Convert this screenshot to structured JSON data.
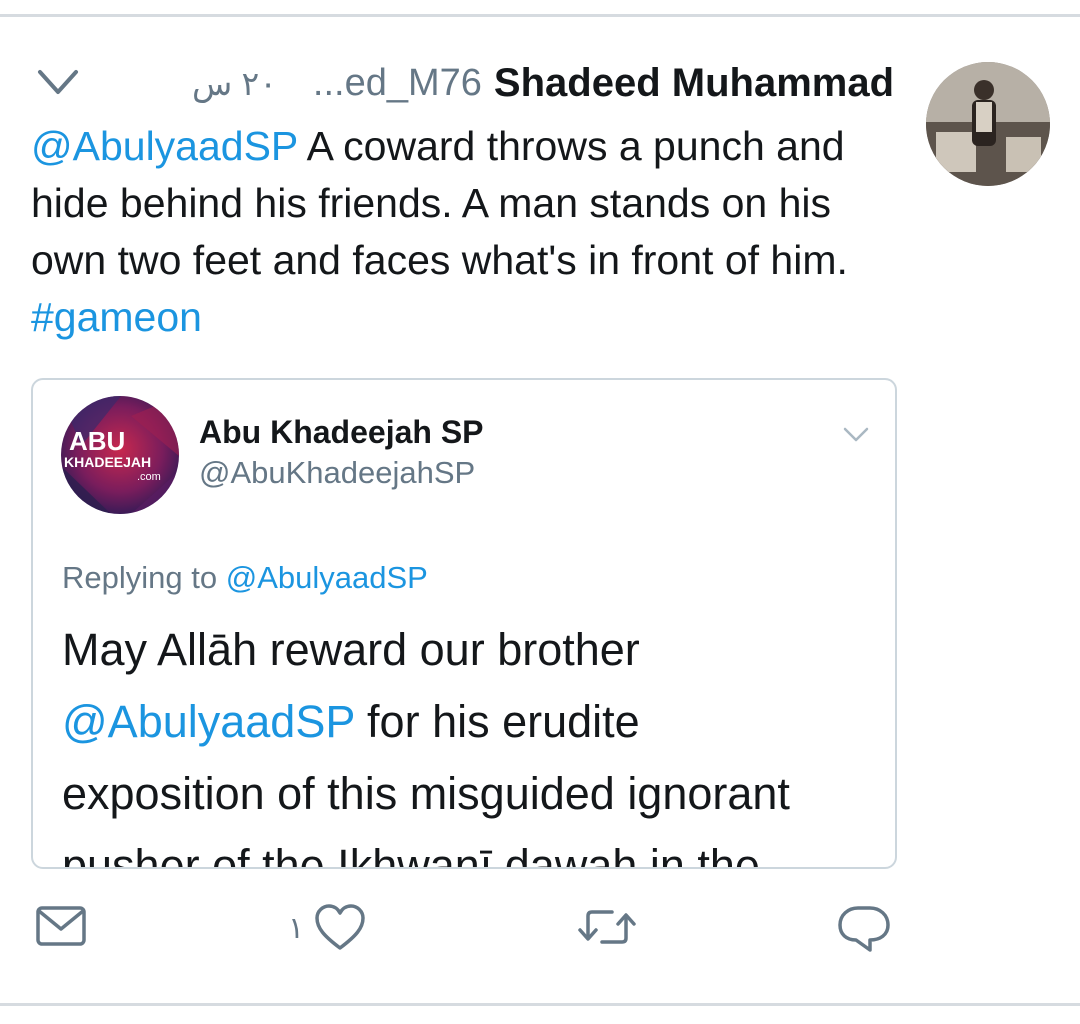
{
  "tweet": {
    "display_name": "Shadeed Muhammad",
    "handle": "...ed_M76",
    "time": "٢٠ س",
    "text": {
      "mention": "@AbulyaadSP",
      "body": " A coward throws a punch and hide behind his friends. A man stands on his own two feet and faces what's in front of him. ",
      "hashtag": "#gameon"
    }
  },
  "quoted_tweet": {
    "avatar_text_top": "ABU",
    "avatar_text_mid": "KHADEEJAH",
    "avatar_text_bottom": ".com",
    "display_name": "Abu Khadeejah SP",
    "handle": "@AbuKhadeejahSP",
    "replying_label": "Replying to ",
    "replying_handle": "@AbulyaadSP",
    "body_line1": "May Allāh reward our brother",
    "body_mention": "@AbulyaadSP",
    "body_line2": " for his erudite",
    "body_line3": "exposition of this misguided ignorant",
    "body_line4": "pusher of the Ikhwanī dawah in the"
  },
  "actions": {
    "like_count": "١",
    "icons": [
      "mail-icon",
      "heart-icon",
      "retweet-icon",
      "reply-icon"
    ]
  },
  "colors": {
    "link": "#1b95e0",
    "secondary_text": "#657786",
    "border": "#ccd6dd"
  }
}
